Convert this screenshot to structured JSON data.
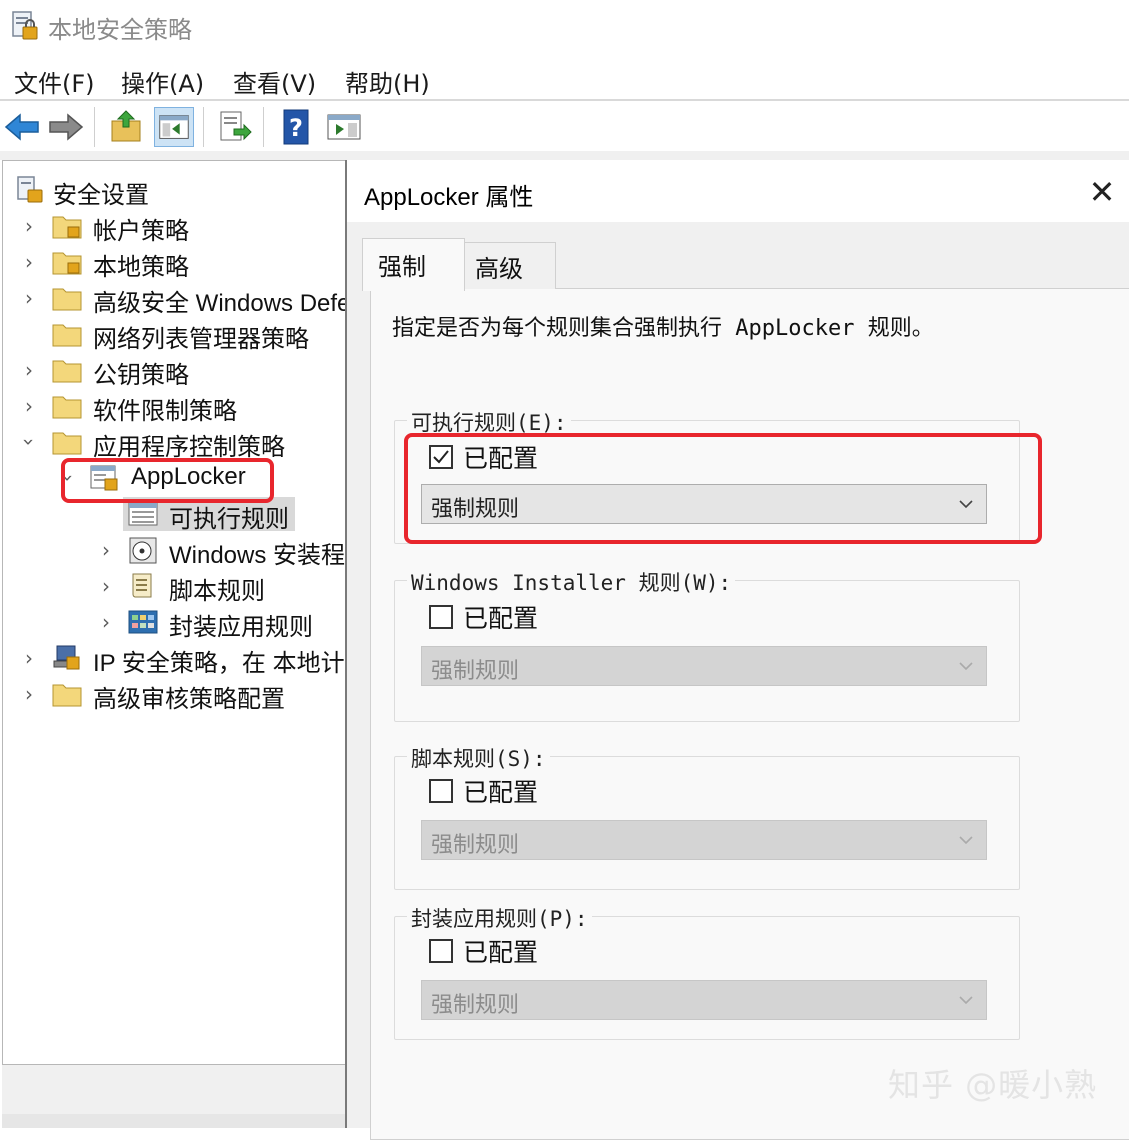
{
  "window": {
    "title": "本地安全策略"
  },
  "menu": [
    "文件(F)",
    "操作(A)",
    "查看(V)",
    "帮助(H)"
  ],
  "toolbar": {
    "buttons": [
      "back-arrow-icon",
      "forward-arrow-icon",
      "up-folder-icon",
      "show-hide-tree-icon",
      "export-list-icon",
      "help-icon",
      "action-pane-icon"
    ]
  },
  "tree": {
    "root": "安全设置",
    "items": [
      {
        "label": "帐户策略"
      },
      {
        "label": "本地策略"
      },
      {
        "label": "高级安全 Windows Defe"
      },
      {
        "label": "网络列表管理器策略"
      },
      {
        "label": "公钥策略"
      },
      {
        "label": "软件限制策略"
      },
      {
        "label": "应用程序控制策略"
      },
      {
        "label": "AppLocker"
      },
      {
        "label": "可执行规则"
      },
      {
        "label": "Windows 安装程"
      },
      {
        "label": "脚本规则"
      },
      {
        "label": "封装应用规则"
      },
      {
        "label": "IP 安全策略，在 本地计"
      },
      {
        "label": "高级审核策略配置"
      }
    ]
  },
  "dialog": {
    "title": "AppLocker 属性",
    "close": "✕",
    "tabs": [
      "强制",
      "高级"
    ],
    "description": "指定是否为每个规则集合强制执行 AppLocker 规则。",
    "groups": [
      {
        "title": "可执行规则(E):",
        "checkbox_label": "已配置",
        "checked": true,
        "select_value": "强制规则",
        "enabled": true
      },
      {
        "title": "Windows Installer 规则(W):",
        "checkbox_label": "已配置",
        "checked": false,
        "select_value": "强制规则",
        "enabled": false
      },
      {
        "title": "脚本规则(S):",
        "checkbox_label": "已配置",
        "checked": false,
        "select_value": "强制规则",
        "enabled": false
      },
      {
        "title": "封装应用规则(P):",
        "checkbox_label": "已配置",
        "checked": false,
        "select_value": "强制规则",
        "enabled": false
      }
    ]
  },
  "watermark": "知乎 @暖小熟",
  "colors": {
    "highlight_box": "#e8262d",
    "selected_row": "#d9d9d9",
    "dialog_bg": "#f0f0f0"
  }
}
